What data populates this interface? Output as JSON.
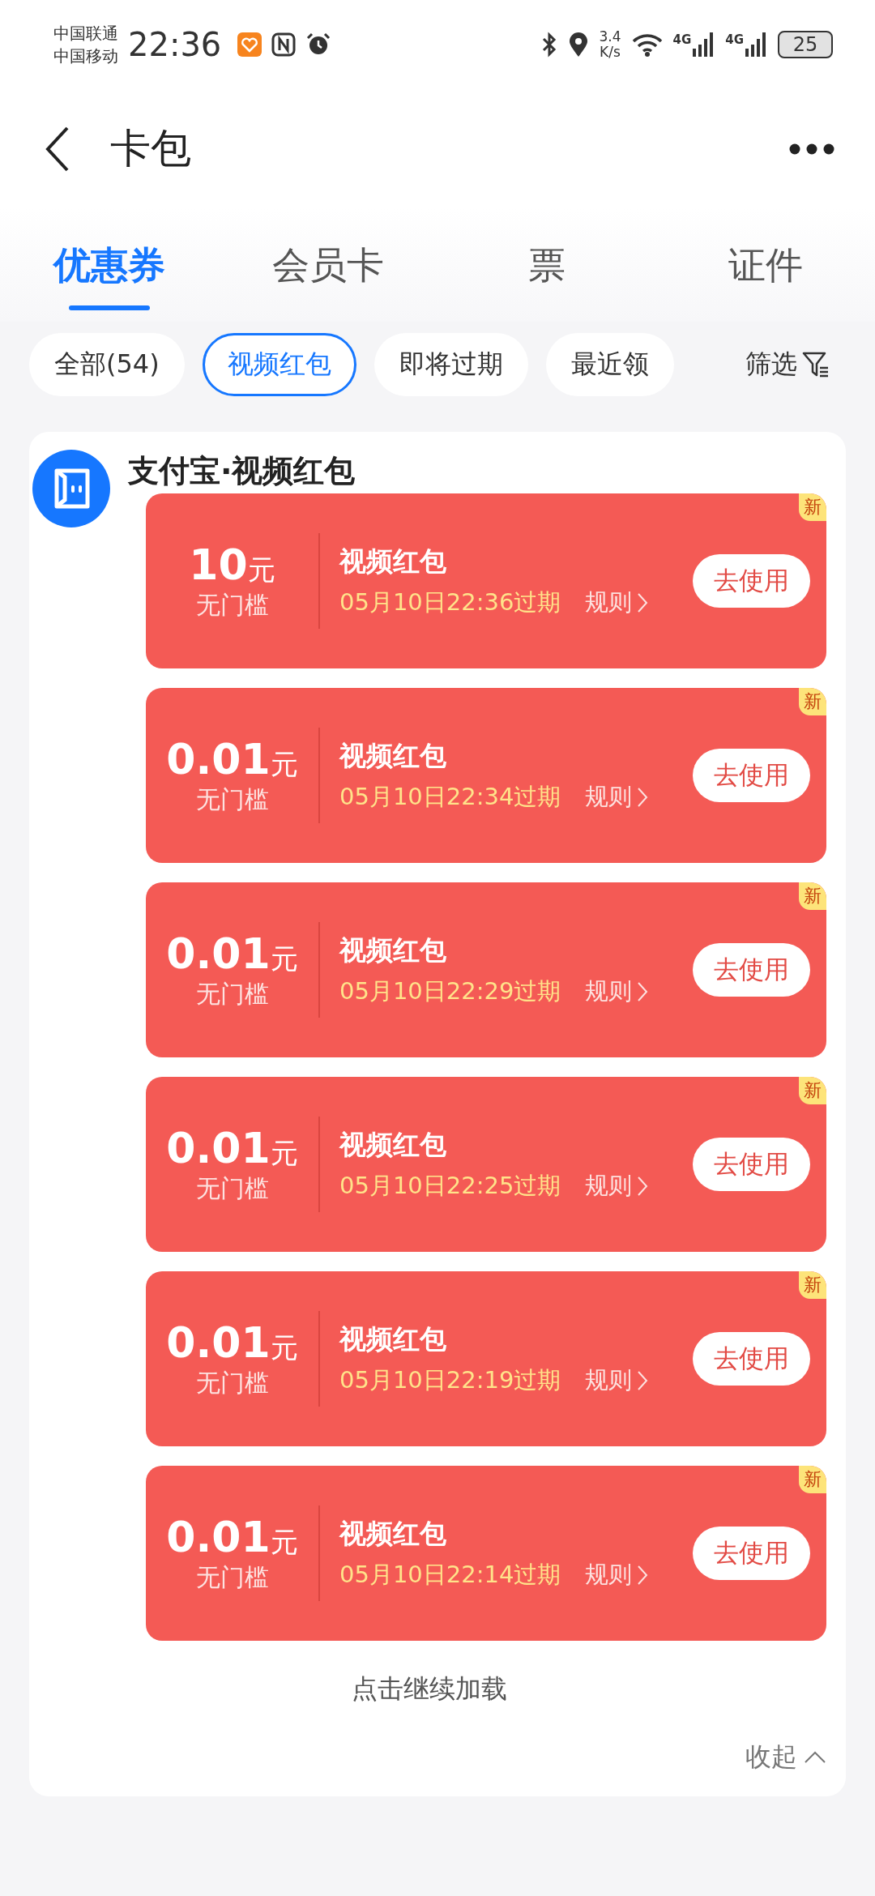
{
  "status_bar": {
    "carriers": [
      "中国联通",
      "中国移动"
    ],
    "time": "22:36",
    "speed_value": "3.4",
    "speed_unit": "K/s",
    "network_labels": [
      "4G",
      "4G"
    ],
    "battery": "25"
  },
  "header": {
    "title": "卡包"
  },
  "tabs": [
    {
      "label": "优惠券",
      "selected": true
    },
    {
      "label": "会员卡",
      "selected": false
    },
    {
      "label": "票",
      "selected": false
    },
    {
      "label": "证件",
      "selected": false
    }
  ],
  "filters": [
    {
      "label": "全部(54)",
      "selected": false
    },
    {
      "label": "视频红包",
      "selected": true
    },
    {
      "label": "即将过期",
      "selected": false
    },
    {
      "label": "最近领",
      "selected": false
    }
  ],
  "filter_button": "筛选",
  "group": {
    "title": "支付宝·视频红包",
    "coupons": [
      {
        "amount": "10",
        "unit": "元",
        "threshold": "无门槛",
        "title": "视频红包",
        "expiry": "05月10日22:36过期",
        "rules": "规则",
        "action": "去使用",
        "badge": "新"
      },
      {
        "amount": "0.01",
        "unit": "元",
        "threshold": "无门槛",
        "title": "视频红包",
        "expiry": "05月10日22:34过期",
        "rules": "规则",
        "action": "去使用",
        "badge": "新"
      },
      {
        "amount": "0.01",
        "unit": "元",
        "threshold": "无门槛",
        "title": "视频红包",
        "expiry": "05月10日22:29过期",
        "rules": "规则",
        "action": "去使用",
        "badge": "新"
      },
      {
        "amount": "0.01",
        "unit": "元",
        "threshold": "无门槛",
        "title": "视频红包",
        "expiry": "05月10日22:25过期",
        "rules": "规则",
        "action": "去使用",
        "badge": "新"
      },
      {
        "amount": "0.01",
        "unit": "元",
        "threshold": "无门槛",
        "title": "视频红包",
        "expiry": "05月10日22:19过期",
        "rules": "规则",
        "action": "去使用",
        "badge": "新"
      },
      {
        "amount": "0.01",
        "unit": "元",
        "threshold": "无门槛",
        "title": "视频红包",
        "expiry": "05月10日22:14过期",
        "rules": "规则",
        "action": "去使用",
        "badge": "新"
      }
    ],
    "load_more": "点击继续加载",
    "collapse": "收起"
  }
}
